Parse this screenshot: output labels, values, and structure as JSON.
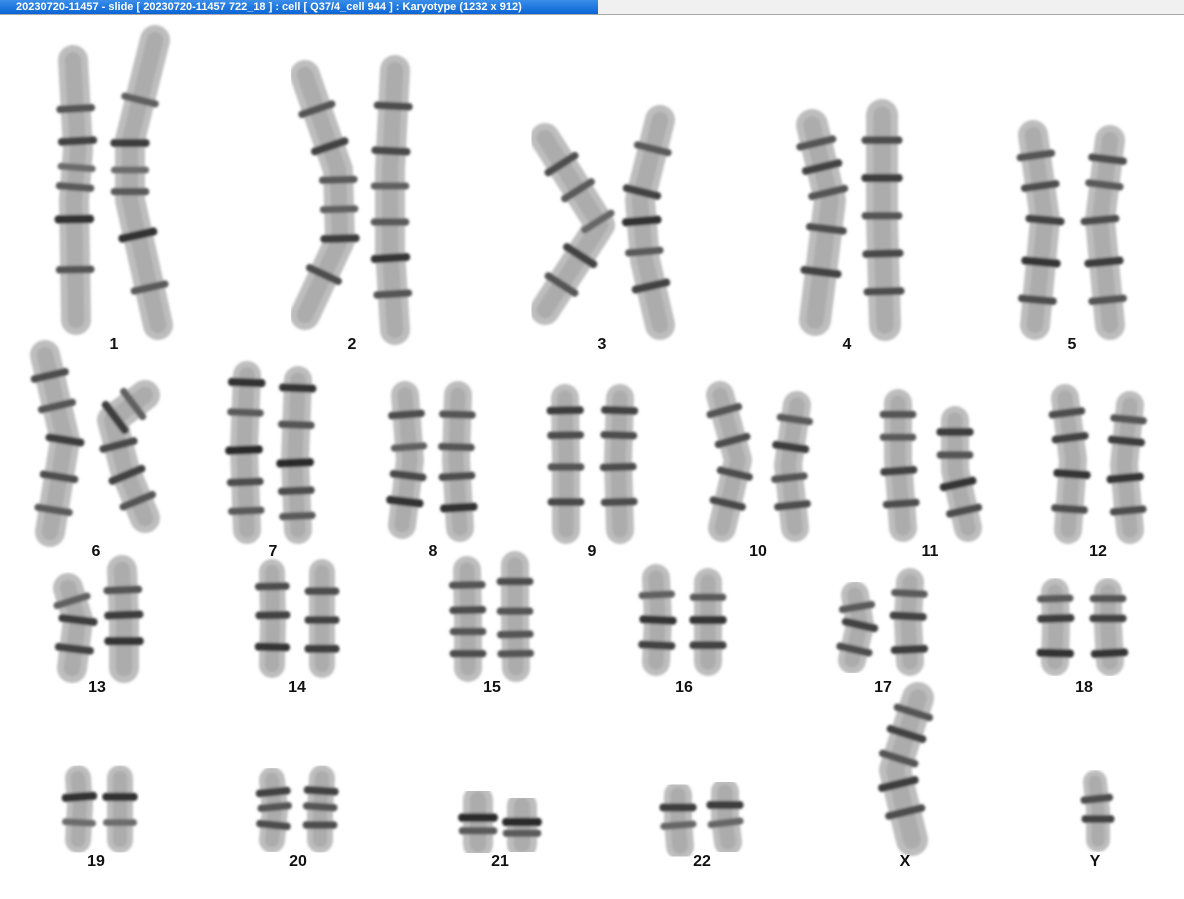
{
  "window": {
    "title": "20230720-11457 - slide [ 20230720-11457 722_18 ] : cell [ Q37/4_cell 944 ] : Karyotype  (1232 x 912)"
  },
  "karyotype": {
    "chromosomes": [
      {
        "label": "1"
      },
      {
        "label": "2"
      },
      {
        "label": "3"
      },
      {
        "label": "4"
      },
      {
        "label": "5"
      },
      {
        "label": "6"
      },
      {
        "label": "7"
      },
      {
        "label": "8"
      },
      {
        "label": "9"
      },
      {
        "label": "10"
      },
      {
        "label": "11"
      },
      {
        "label": "12"
      },
      {
        "label": "13"
      },
      {
        "label": "14"
      },
      {
        "label": "15"
      },
      {
        "label": "16"
      },
      {
        "label": "17"
      },
      {
        "label": "18"
      },
      {
        "label": "19"
      },
      {
        "label": "20"
      },
      {
        "label": "21"
      },
      {
        "label": "22"
      },
      {
        "label": "X"
      },
      {
        "label": "Y"
      }
    ]
  }
}
